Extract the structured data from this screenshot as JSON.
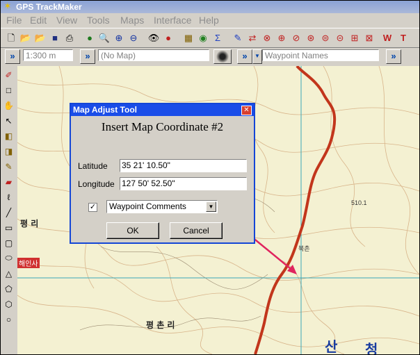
{
  "window": {
    "title": "GPS TrackMaker"
  },
  "menu": [
    "File",
    "Edit",
    "View",
    "Tools",
    "Maps",
    "Interface",
    "Help"
  ],
  "toolbar2": {
    "scale_value": "1:300 m",
    "map_value": "(No Map)",
    "names_value": "Waypoint Names"
  },
  "map_labels": {
    "village1": "평 리",
    "village2": "평 촌 리",
    "big1": "산",
    "big2": "청",
    "temple": "해인사",
    "spot": "북촌",
    "elev": "510.1"
  },
  "dialog": {
    "title": "Map Adjust Tool",
    "heading": "Insert Map Coordinate #2",
    "latitude_label": "Latitude",
    "latitude_value": "35 21' 10.50\"",
    "longitude_label": "Longitude",
    "longitude_value": "127 50' 52.50\"",
    "checkbox_mark": "✓",
    "combo_value": "Waypoint Comments",
    "ok_label": "OK",
    "cancel_label": "Cancel"
  },
  "colors": {
    "road": "#c2361c",
    "grid": "#3aa7b8",
    "arrow": "#e0245e",
    "dialog_border": "#1446d6"
  }
}
